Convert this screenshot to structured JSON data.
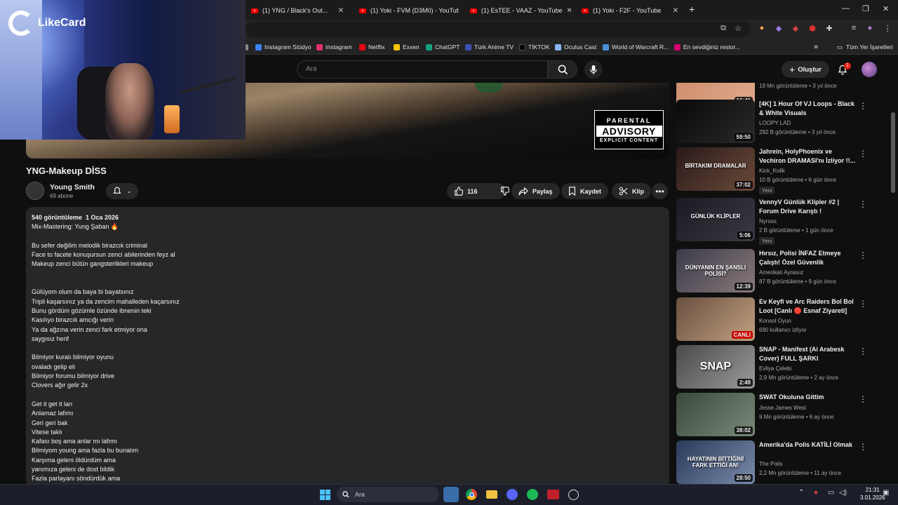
{
  "browser": {
    "tabs": [
      {
        "title": "(1) YNG / Black's Out..."
      },
      {
        "title": "(1) Yoki - FVM (D3M0) - YouTub"
      },
      {
        "title": "(1) EsTEE - VAAZ - YouTube"
      },
      {
        "title": "(1) Yoki - F2F - YouTube"
      }
    ],
    "new_tab": "+",
    "bookmarks": [
      {
        "label": "Instagram Stüdyo",
        "color": "#3b82f6"
      },
      {
        "label": "Instagram",
        "color": "#e1306c"
      },
      {
        "label": "Netflix",
        "color": "#e50914"
      },
      {
        "label": "Exxen",
        "color": "#f5c400"
      },
      {
        "label": "ChatGPT",
        "color": "#10a37f"
      },
      {
        "label": "Türk Anime TV",
        "color": "#3f51b5"
      },
      {
        "label": "TİKTOK",
        "color": "#000000"
      },
      {
        "label": "Oculus Cast",
        "color": "#8ab4f8"
      },
      {
        "label": "World of Warcraft R...",
        "color": "#4a90d9"
      },
      {
        "label": "En sevdiğiniz restor...",
        "color": "#d6006f"
      }
    ],
    "all_bookmarks": "Tüm Yer İşaretleri"
  },
  "overlay": {
    "logo_text": "LikeCard"
  },
  "youtube": {
    "search_placeholder": "Ara",
    "create_label": "Oluştur",
    "notification_count": "1",
    "video": {
      "title": "YNG-Makeup DİSS",
      "channel": "Young Smith",
      "subscribers": "69 abone",
      "likes": "116",
      "share": "Paylaş",
      "save": "Kaydet",
      "clip": "Klip",
      "advisory": {
        "line1": "PARENTAL",
        "line2": "ADVISORY",
        "line3": "EXPLICIT CONTENT"
      }
    },
    "description": {
      "views_date": "540 görüntüleme  1 Oca 2026",
      "lines": [
        "Mix-Mastering: Yung Şaban 🔥",
        "",
        "Bu sefer değilim melodik birazcık criminal",
        "Face to facete konuşursun zenci abilerinden feyz al",
        "Makeup zenci bütün gangsterlikleri makeup",
        "",
        "",
        "Gülüyom olum da baya bi bayatsınız",
        "Tripli kaşarsınız ya da zencim mahalleden kaçarsınız",
        "Bunu gördüm gözümle özünde ibnenin teki",
        "Kasılıyo birazcık amcığı verin",
        "Ya da ağzına verin zenci fark etmiyor ona",
        "saygısız herif",
        "",
        "Bilmiyor kuralı bilmiyor oyunu",
        "ovaladı gelip eli",
        "Bilmiyor forumu bilmiyor drive",
        "Clovers ağır gelir 2x",
        "",
        "Get it get it lan",
        "Anlamaz lafımı",
        "Geri geri bak",
        "Vitese taklı",
        "Kafası boş ama anlar mı lafımı",
        "Bilmiyom young ama fazla bu bunalım",
        "Karşıma geleni öldürdüm ama",
        "yanımıza geleni de dost bildik",
        "Fazla parlayanı söndürdük ama"
      ]
    },
    "recommendations": [
      {
        "title": "",
        "channel": "",
        "meta": "19 Mn görüntüleme • 3 yıl önce",
        "duration": "16:41",
        "badge": "",
        "colors": [
          "#c98a6a",
          "#e0a98a"
        ],
        "thumb_text": ""
      },
      {
        "title": "[4K] 1 Hour Of VJ Loops - Black & White Visuals",
        "channel": "LOOPY LAD",
        "meta": "292 B görüntüleme • 3 yıl önce",
        "duration": "59:50",
        "badge": "",
        "colors": [
          "#0a0a0a",
          "#2a2a2a"
        ],
        "thumb_text": ""
      },
      {
        "title": "Jahrein, HolyPhoenix ve Vechiron DRAMASI'nı İzliyor !!...",
        "channel": "Kick_Kolik",
        "meta": "10 B görüntüleme • 6 gün önce",
        "duration": "37:02",
        "badge": "Yeni",
        "colors": [
          "#2a1a1a",
          "#6a4a3a"
        ],
        "thumb_text": "BİRTAKIM DRAMALAR"
      },
      {
        "title": "VennyV Günlük Klipler #2 | Forum Drive Karıştı !",
        "channel": "Nyross",
        "meta": "2 B görüntüleme • 1 gün önce",
        "duration": "5:06",
        "badge": "Yeni",
        "colors": [
          "#1a1a22",
          "#3a3a44"
        ],
        "thumb_text": "GÜNLÜK KLİPLER"
      },
      {
        "title": "Hırsız, Polisi İNFAZ Etmeye Çalıştı! Özel Güvenlik HERKESİ...",
        "channel": "Amerikalı Aynasız",
        "meta": "87 B görüntüleme • 9 gün önce",
        "duration": "12:39",
        "badge": "",
        "colors": [
          "#3a3a4a",
          "#8a7a7a"
        ],
        "thumb_text": "DÜNYANIN EN ŞANSLI POLİSİ?"
      },
      {
        "title": "Ev Keyfi ve Arc Raiders Bol Bol Loot [Canlı 🔴 Esnaf Ziyareti]",
        "channel": "Konsol Oyun",
        "meta": "690 kullanıcı izliyor",
        "duration": "CANLI",
        "badge": "",
        "colors": [
          "#6a5040",
          "#c0a080"
        ],
        "thumb_text": ""
      },
      {
        "title": "SNAP - Manifest (Ai Arabesk Cover) FULL ŞARKI",
        "channel": "Evliya Çelebi",
        "meta": "2,9 Mn görüntüleme • 2 ay önce",
        "duration": "2:49",
        "badge": "",
        "colors": [
          "#4a4a4a",
          "#9a9a9a"
        ],
        "thumb_text": "SNAP"
      },
      {
        "title": "SWAT Okuluna Gittim",
        "channel": "Jesse James West",
        "meta": "9 Mn görüntüleme • 6 ay önce",
        "duration": "38:02",
        "badge": "",
        "colors": [
          "#3a4a3a",
          "#7a8a7a"
        ],
        "thumb_text": ""
      },
      {
        "title": "Amerika'da Polis KATİLİ Olmak",
        "channel": "The Polis",
        "meta": "2,2 Mn görüntüleme • 11 ay önce",
        "duration": "28:50",
        "badge": "",
        "colors": [
          "#2a3a5a",
          "#7a8aaa"
        ],
        "thumb_text": "HAYATININ BİTTİĞİNİ FARK ETTİĞİ AN!"
      }
    ]
  },
  "taskbar": {
    "search_placeholder": "Ara",
    "time": "21:31",
    "date": "3.01.2026"
  }
}
